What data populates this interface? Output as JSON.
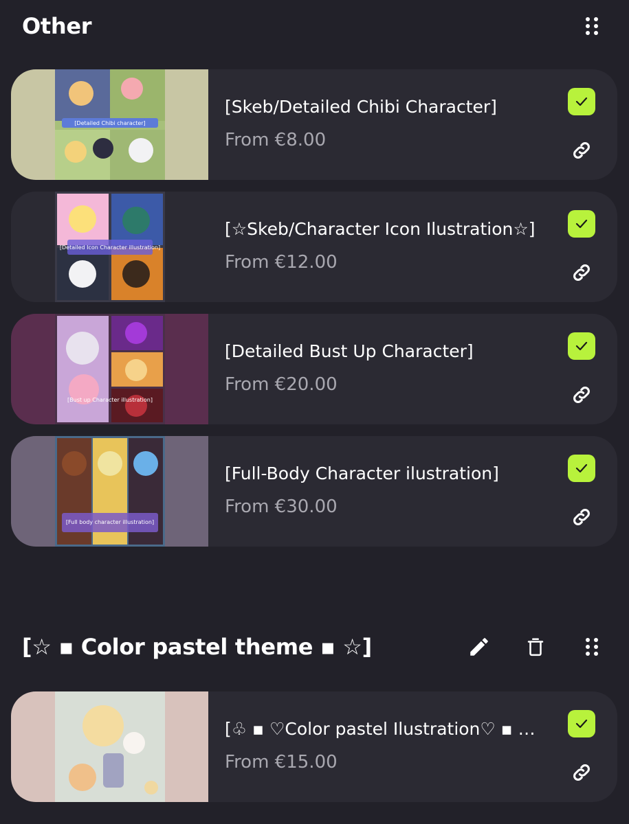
{
  "sections": [
    {
      "title": "Other",
      "items": [
        {
          "title": "[Skeb/Detailed Chibi Character]",
          "price": "From €8.00",
          "enabled": true,
          "thumb_caption": "[Detailed Chibi character]",
          "bg": "#c8c6a4",
          "art": "#a7c07a"
        },
        {
          "title": "[☆Skeb/Character Icon Ilustration☆]",
          "price": "From €12.00",
          "enabled": true,
          "thumb_caption": "[Detailed Icon Character illustration]",
          "bg": "#2b2a33",
          "art": "#6a7aa8"
        },
        {
          "title": "[Detailed Bust Up Character]",
          "price": "From €20.00",
          "enabled": true,
          "thumb_caption": "[Bust up Character illustration]",
          "bg": "#5a2e4e",
          "art": "#8a4e88"
        },
        {
          "title": "[Full-Body Character ilustration]",
          "price": "From €30.00",
          "enabled": true,
          "thumb_caption": "[Full body character illustration]",
          "bg": "#6e6478",
          "art": "#9a7ab0"
        }
      ]
    },
    {
      "title": "[☆ ▪ Color pastel theme ▪ ☆]",
      "items": [
        {
          "title": "[♧ ▪ ♡Color pastel Ilustration♡ ▪ …",
          "price": "From €15.00",
          "enabled": true,
          "thumb_caption": "",
          "bg": "#d8c2bc",
          "art": "#e8dcc4"
        }
      ]
    }
  ],
  "colors": {
    "background": "#222129",
    "card": "#2b2a33",
    "accent": "#b8f23c",
    "price_text": "#a9a8b0"
  },
  "icons": {
    "drag": "drag-handle-icon",
    "edit": "pencil-icon",
    "delete": "trash-icon",
    "toggle": "check-icon",
    "link": "link-icon"
  }
}
